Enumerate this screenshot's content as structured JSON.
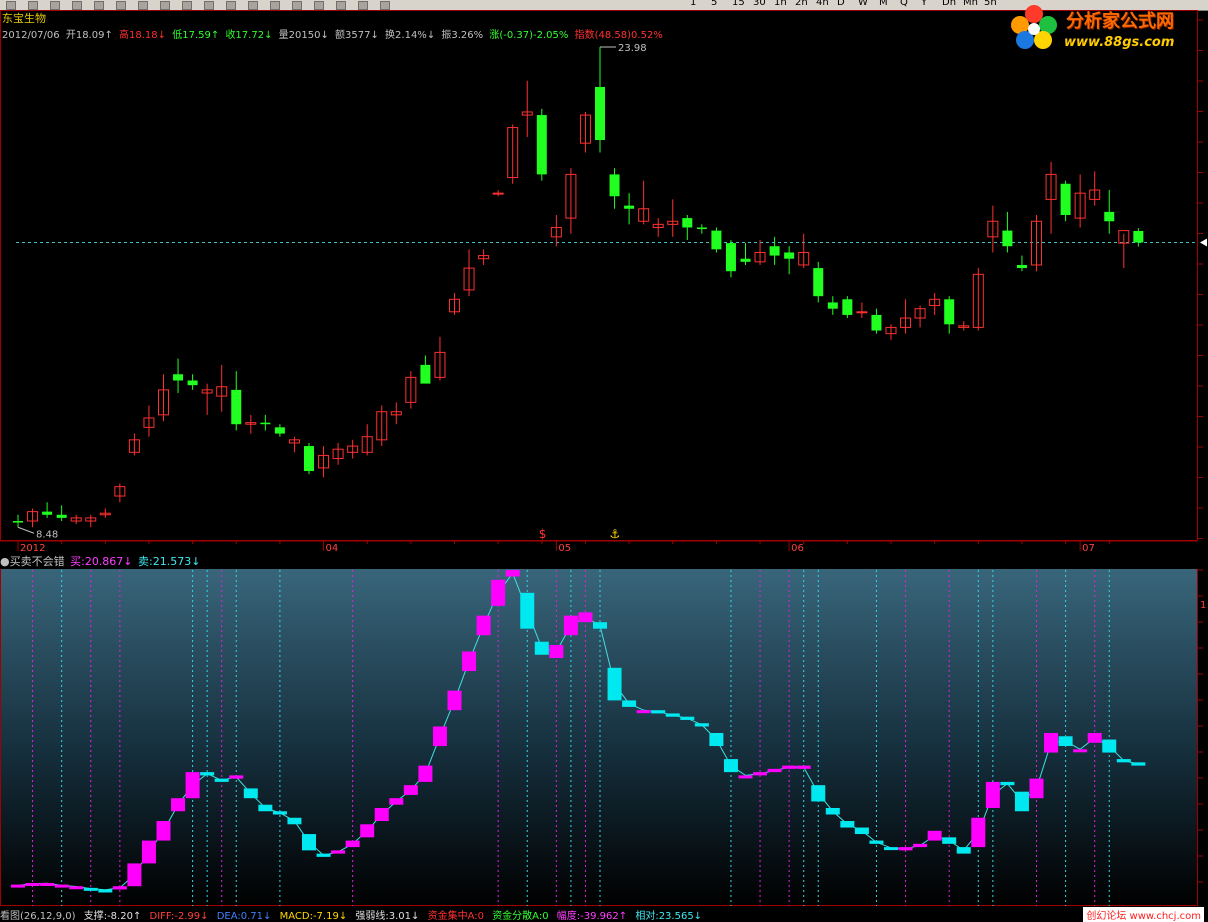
{
  "toolbar": {
    "periods": [
      "1",
      "5",
      "15",
      "30",
      "1h",
      "2h",
      "4h",
      "D",
      "W",
      "M",
      "Q",
      "Y",
      "Dh",
      "Mn",
      "5h"
    ]
  },
  "stock": {
    "name": "东宝生物",
    "date": "2012/07/06",
    "open": "开18.09↑",
    "high": "高18.18↓",
    "low": "低17.59↑",
    "close": "收17.72↓",
    "volume": "量20150↓",
    "amount": "额3577↓",
    "turnover": "换2.14%↓",
    "amplitude": "振3.26%",
    "change": "涨(-0.37)-2.05%",
    "index": "指数(48.58)0.52%"
  },
  "logo": {
    "title": "分析家公式网",
    "url": "www.88gs.com"
  },
  "watermark": "创幻论坛 www.chcj.com",
  "subchart": {
    "title": "●买卖不会错",
    "buy": "买:20.867↓",
    "sell": "卖:21.573↓"
  },
  "bottom": {
    "label": "看图(26,12,9,0)",
    "support": "支撑:-8.20↑",
    "diff": "DIFF:-2.99↓",
    "dea": "DEA:0.71↓",
    "macd": "MACD:-7.19↓",
    "strong": "强弱线:3.01↓",
    "fund_concentrate": "资金集中A:0",
    "fund_disperse": "资金分散A:0",
    "amp": "幅度:-39.962↑",
    "relative": "相对:23.565↓"
  },
  "chart_data": [
    {
      "type": "candlestick",
      "series_name": "东宝生物",
      "x_month_labels": [
        "2012",
        "04",
        "05",
        "06",
        "07"
      ],
      "price_max_label": "23.98",
      "price_min_label": "8.48",
      "reference_line": 17.72,
      "marker_symbols": [
        "$",
        "⚓"
      ],
      "colors": {
        "up": "#ff3030",
        "down": "#20ff20",
        "reference": "#40c0c0"
      },
      "ohlc": [
        [
          8.8,
          9.0,
          8.6,
          8.75
        ],
        [
          8.8,
          9.2,
          8.6,
          9.1
        ],
        [
          9.1,
          9.4,
          8.9,
          9.0
        ],
        [
          9.0,
          9.3,
          8.8,
          8.9
        ],
        [
          8.8,
          9.0,
          8.7,
          8.9
        ],
        [
          8.8,
          9.0,
          8.6,
          8.9
        ],
        [
          9.0,
          9.2,
          8.9,
          9.05
        ],
        [
          9.6,
          10.0,
          9.4,
          9.9
        ],
        [
          11.0,
          11.6,
          10.9,
          11.4
        ],
        [
          11.8,
          12.5,
          11.5,
          12.1
        ],
        [
          12.2,
          13.5,
          12.0,
          13.0
        ],
        [
          13.5,
          14.0,
          12.9,
          13.3
        ],
        [
          13.3,
          13.5,
          13.0,
          13.15
        ],
        [
          12.9,
          13.2,
          12.2,
          13.0
        ],
        [
          12.8,
          13.8,
          12.3,
          13.1
        ],
        [
          13.0,
          13.6,
          11.7,
          11.9
        ],
        [
          11.9,
          12.2,
          11.6,
          11.95
        ],
        [
          11.95,
          12.2,
          11.7,
          11.9
        ],
        [
          11.8,
          11.9,
          11.5,
          11.6
        ],
        [
          11.3,
          11.5,
          11.0,
          11.4
        ],
        [
          11.2,
          11.3,
          10.3,
          10.4
        ],
        [
          10.5,
          11.2,
          10.2,
          10.9
        ],
        [
          10.8,
          11.3,
          10.6,
          11.1
        ],
        [
          11.0,
          11.4,
          10.8,
          11.2
        ],
        [
          11.0,
          11.9,
          10.9,
          11.5
        ],
        [
          11.4,
          12.5,
          11.2,
          12.3
        ],
        [
          12.2,
          12.6,
          11.9,
          12.3
        ],
        [
          12.6,
          13.6,
          12.4,
          13.4
        ],
        [
          13.8,
          14.1,
          13.5,
          13.2
        ],
        [
          13.4,
          14.7,
          13.3,
          14.2
        ],
        [
          15.5,
          16.1,
          15.4,
          15.9
        ],
        [
          16.2,
          17.5,
          16.0,
          16.9
        ],
        [
          17.2,
          17.5,
          17.0,
          17.3
        ],
        [
          19.3,
          19.4,
          19.2,
          19.3
        ],
        [
          19.8,
          21.5,
          19.6,
          21.4
        ],
        [
          21.8,
          22.9,
          21.1,
          21.9
        ],
        [
          21.8,
          22.0,
          19.7,
          19.9
        ],
        [
          17.9,
          18.6,
          17.6,
          18.2
        ],
        [
          18.5,
          20.1,
          18.0,
          19.9
        ],
        [
          20.9,
          21.9,
          20.6,
          21.8
        ],
        [
          22.7,
          23.98,
          20.6,
          21.0
        ],
        [
          19.9,
          20.1,
          18.8,
          19.2
        ],
        [
          18.9,
          19.3,
          18.3,
          18.8
        ],
        [
          18.4,
          19.7,
          18.3,
          18.8
        ],
        [
          18.2,
          18.5,
          17.9,
          18.3
        ],
        [
          18.3,
          19.1,
          17.9,
          18.4
        ],
        [
          18.5,
          18.6,
          17.8,
          18.2
        ],
        [
          18.2,
          18.3,
          18.0,
          18.15
        ],
        [
          18.1,
          18.2,
          17.4,
          17.5
        ],
        [
          17.7,
          17.8,
          16.6,
          16.8
        ],
        [
          17.2,
          17.7,
          17.0,
          17.1
        ],
        [
          17.1,
          17.8,
          17.0,
          17.4
        ],
        [
          17.6,
          17.9,
          17.0,
          17.3
        ],
        [
          17.4,
          17.6,
          16.7,
          17.2
        ],
        [
          17.0,
          18.0,
          16.9,
          17.4
        ],
        [
          16.9,
          17.1,
          15.8,
          16.0
        ],
        [
          15.8,
          16.0,
          15.4,
          15.6
        ],
        [
          15.9,
          16.0,
          15.3,
          15.4
        ],
        [
          15.5,
          15.8,
          15.3,
          15.5
        ],
        [
          15.4,
          15.6,
          14.8,
          14.9
        ],
        [
          14.8,
          15.1,
          14.6,
          15.0
        ],
        [
          15.0,
          15.9,
          14.8,
          15.3
        ],
        [
          15.3,
          15.7,
          15.0,
          15.6
        ],
        [
          15.7,
          16.1,
          15.4,
          15.9
        ],
        [
          15.9,
          16.0,
          14.8,
          15.1
        ],
        [
          15.0,
          15.2,
          14.9,
          15.05
        ],
        [
          15.0,
          16.9,
          14.9,
          16.7
        ],
        [
          17.9,
          18.9,
          17.4,
          18.4
        ],
        [
          18.1,
          18.7,
          17.4,
          17.6
        ],
        [
          17.0,
          17.3,
          16.8,
          16.9
        ],
        [
          17.0,
          18.6,
          16.8,
          18.4
        ],
        [
          19.1,
          20.3,
          18.0,
          19.9
        ],
        [
          19.6,
          19.7,
          18.4,
          18.6
        ],
        [
          18.5,
          19.9,
          18.2,
          19.3
        ],
        [
          19.1,
          20.0,
          18.9,
          19.4
        ],
        [
          18.7,
          19.4,
          18.0,
          18.4
        ],
        [
          17.7,
          18.0,
          16.9,
          18.1
        ],
        [
          18.09,
          18.18,
          17.59,
          17.72
        ]
      ]
    },
    {
      "type": "indicator-boxes",
      "series_name": "买卖不会错",
      "colors": {
        "up": "#ff00ff",
        "down": "#00e8f0",
        "line": "#40e0e0"
      },
      "levels": [
        [
          0.03,
          0.035
        ],
        [
          0.035,
          0.04
        ],
        [
          0.038,
          0.04
        ],
        [
          0.03,
          0.035
        ],
        [
          0.028,
          0.03
        ],
        [
          0.025,
          0.02
        ],
        [
          0.02,
          0.018
        ],
        [
          0.02,
          0.03
        ],
        [
          0.03,
          0.1
        ],
        [
          0.1,
          0.17
        ],
        [
          0.17,
          0.23
        ],
        [
          0.26,
          0.3
        ],
        [
          0.3,
          0.38
        ],
        [
          0.38,
          0.37
        ],
        [
          0.36,
          0.35
        ],
        [
          0.36,
          0.37
        ],
        [
          0.33,
          0.3
        ],
        [
          0.28,
          0.26
        ],
        [
          0.26,
          0.25
        ],
        [
          0.24,
          0.22
        ],
        [
          0.19,
          0.14
        ],
        [
          0.13,
          0.12
        ],
        [
          0.13,
          0.14
        ],
        [
          0.15,
          0.17
        ],
        [
          0.18,
          0.22
        ],
        [
          0.23,
          0.27
        ],
        [
          0.28,
          0.3
        ],
        [
          0.31,
          0.34
        ],
        [
          0.35,
          0.4
        ],
        [
          0.46,
          0.52
        ],
        [
          0.57,
          0.63
        ],
        [
          0.69,
          0.75
        ],
        [
          0.8,
          0.86
        ],
        [
          0.89,
          0.97
        ],
        [
          0.98,
          1.0
        ],
        [
          0.93,
          0.82
        ],
        [
          0.78,
          0.74
        ],
        [
          0.73,
          0.77
        ],
        [
          0.8,
          0.86
        ],
        [
          0.84,
          0.87
        ],
        [
          0.84,
          0.82
        ],
        [
          0.7,
          0.6
        ],
        [
          0.6,
          0.58
        ],
        [
          0.57,
          0.57
        ],
        [
          0.57,
          0.56
        ],
        [
          0.56,
          0.55
        ],
        [
          0.55,
          0.54
        ],
        [
          0.53,
          0.52
        ],
        [
          0.5,
          0.46
        ],
        [
          0.42,
          0.38
        ],
        [
          0.37,
          0.37
        ],
        [
          0.37,
          0.38
        ],
        [
          0.38,
          0.39
        ],
        [
          0.39,
          0.4
        ],
        [
          0.39,
          0.4
        ],
        [
          0.34,
          0.29
        ],
        [
          0.27,
          0.25
        ],
        [
          0.23,
          0.21
        ],
        [
          0.21,
          0.19
        ],
        [
          0.17,
          0.16
        ],
        [
          0.15,
          0.145
        ],
        [
          0.14,
          0.15
        ],
        [
          0.15,
          0.16
        ],
        [
          0.17,
          0.2
        ],
        [
          0.18,
          0.16
        ],
        [
          0.15,
          0.13
        ],
        [
          0.15,
          0.24
        ],
        [
          0.27,
          0.35
        ],
        [
          0.35,
          0.34
        ],
        [
          0.32,
          0.26
        ],
        [
          0.3,
          0.36
        ],
        [
          0.44,
          0.5
        ],
        [
          0.49,
          0.46
        ],
        [
          0.45,
          0.45
        ],
        [
          0.47,
          0.5
        ],
        [
          0.48,
          0.44
        ],
        [
          0.42,
          0.41
        ],
        [
          0.41,
          0.4
        ]
      ],
      "vertical_markers": [
        {
          "i": 1,
          "c": "m"
        },
        {
          "i": 3,
          "c": "c"
        },
        {
          "i": 5,
          "c": "m"
        },
        {
          "i": 7,
          "c": "m"
        },
        {
          "i": 12,
          "c": "c"
        },
        {
          "i": 13,
          "c": "c"
        },
        {
          "i": 14,
          "c": "m"
        },
        {
          "i": 15,
          "c": "c"
        },
        {
          "i": 18,
          "c": "c"
        },
        {
          "i": 23,
          "c": "m"
        },
        {
          "i": 33,
          "c": "m"
        },
        {
          "i": 35,
          "c": "c"
        },
        {
          "i": 37,
          "c": "m"
        },
        {
          "i": 38,
          "c": "c"
        },
        {
          "i": 39,
          "c": "m"
        },
        {
          "i": 40,
          "c": "c"
        },
        {
          "i": 49,
          "c": "c"
        },
        {
          "i": 51,
          "c": "m"
        },
        {
          "i": 53,
          "c": "m"
        },
        {
          "i": 54,
          "c": "c"
        },
        {
          "i": 55,
          "c": "c"
        },
        {
          "i": 59,
          "c": "c"
        },
        {
          "i": 61,
          "c": "m"
        },
        {
          "i": 64,
          "c": "m"
        },
        {
          "i": 66,
          "c": "c"
        },
        {
          "i": 67,
          "c": "c"
        },
        {
          "i": 70,
          "c": "m"
        },
        {
          "i": 72,
          "c": "c"
        },
        {
          "i": 74,
          "c": "m"
        },
        {
          "i": 75,
          "c": "c"
        }
      ]
    }
  ]
}
